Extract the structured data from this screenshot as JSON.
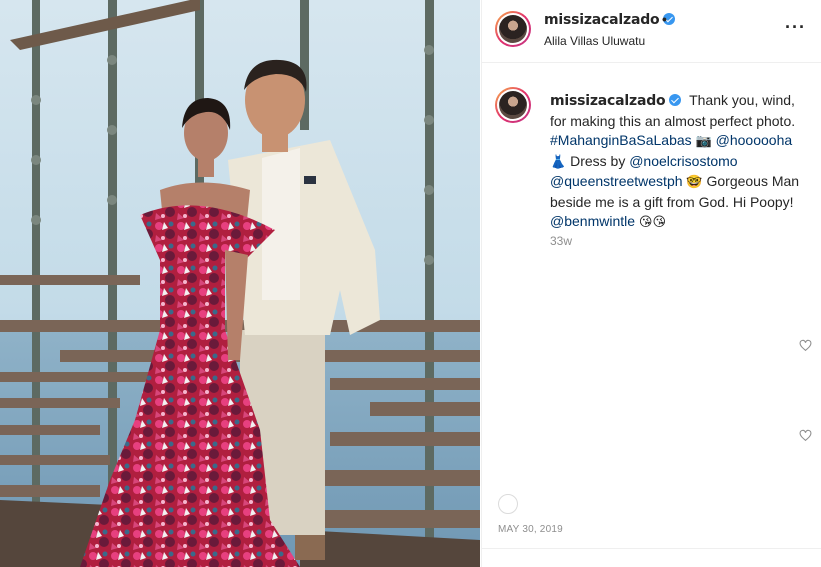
{
  "post": {
    "username": "missizacalzado",
    "location": "Alila Villas Uluwatu",
    "more_icon": "more-horizontal-icon",
    "caption": {
      "username": "missizacalzado",
      "text1": "Thank you, wind, for making this an almost perfect photo.",
      "hashtag": "#MahanginBaSaLabas",
      "camera_emoji": "📷",
      "mention1": "@hoooooha",
      "dress_emoji": "👗",
      "text2": "Dress by",
      "mention2": "@noelcrisostomo",
      "mention3": "@queenstreetwestph",
      "smile_emoji": "🤓",
      "text3": "Gorgeous Man beside me is a gift from God. Hi Poopy!",
      "mention4": "@benmwintle",
      "kiss_emojis": "😘😘"
    },
    "age": "33w",
    "date": "MAY 30, 2019"
  },
  "colors": {
    "verified": "#3897f0",
    "link": "#003569",
    "muted": "#8e8e8e"
  }
}
